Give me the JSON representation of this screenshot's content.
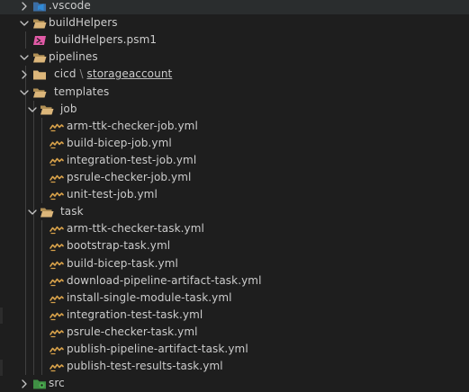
{
  "explorer": {
    "rows": [
      {
        "name": ".vscode",
        "type": "folder",
        "icon": "vscode-folder-icon",
        "expanded": false,
        "depth": 0
      },
      {
        "name": "buildHelpers",
        "type": "folder",
        "icon": "folder-open-icon",
        "expanded": true,
        "depth": 0
      },
      {
        "name": "buildHelpers.psm1",
        "type": "file",
        "icon": "powershell-file-icon",
        "depth": 1
      },
      {
        "name": "pipelines",
        "type": "folder",
        "icon": "folder-open-icon",
        "expanded": true,
        "depth": 0
      },
      {
        "name": "cicd",
        "name_sep": "\\",
        "name_sub": "storageaccount",
        "type": "folder",
        "icon": "folder-icon",
        "expanded": false,
        "depth": 1
      },
      {
        "name": "templates",
        "type": "folder",
        "icon": "folder-open-icon",
        "expanded": true,
        "depth": 1
      },
      {
        "name": "job",
        "type": "folder",
        "icon": "folder-open-icon",
        "expanded": true,
        "depth": 2
      },
      {
        "name": "arm-ttk-checker-job.yml",
        "type": "file",
        "icon": "yaml-file-icon",
        "depth": 3
      },
      {
        "name": "build-bicep-job.yml",
        "type": "file",
        "icon": "yaml-file-icon",
        "depth": 3
      },
      {
        "name": "integration-test-job.yml",
        "type": "file",
        "icon": "yaml-file-icon",
        "depth": 3
      },
      {
        "name": "psrule-checker-job.yml",
        "type": "file",
        "icon": "yaml-file-icon",
        "depth": 3
      },
      {
        "name": "unit-test-job.yml",
        "type": "file",
        "icon": "yaml-file-icon",
        "depth": 3
      },
      {
        "name": "task",
        "type": "folder",
        "icon": "folder-open-icon",
        "expanded": true,
        "depth": 2
      },
      {
        "name": "arm-ttk-checker-task.yml",
        "type": "file",
        "icon": "yaml-file-icon",
        "depth": 3
      },
      {
        "name": "bootstrap-task.yml",
        "type": "file",
        "icon": "yaml-file-icon",
        "depth": 3
      },
      {
        "name": "build-bicep-task.yml",
        "type": "file",
        "icon": "yaml-file-icon",
        "depth": 3
      },
      {
        "name": "download-pipeline-artifact-task.yml",
        "type": "file",
        "icon": "yaml-file-icon",
        "depth": 3
      },
      {
        "name": "install-single-module-task.yml",
        "type": "file",
        "icon": "yaml-file-icon",
        "depth": 3
      },
      {
        "name": "integration-test-task.yml",
        "type": "file",
        "icon": "yaml-file-icon",
        "depth": 3
      },
      {
        "name": "psrule-checker-task.yml",
        "type": "file",
        "icon": "yaml-file-icon",
        "depth": 3
      },
      {
        "name": "publish-pipeline-artifact-task.yml",
        "type": "file",
        "icon": "yaml-file-icon",
        "depth": 3
      },
      {
        "name": "publish-test-results-task.yml",
        "type": "file",
        "icon": "yaml-file-icon",
        "depth": 3
      },
      {
        "name": "src",
        "type": "folder",
        "icon": "src-folder-icon",
        "expanded": false,
        "depth": 0
      }
    ]
  },
  "colors": {
    "background": "#1e1e1e",
    "text": "#cccccc",
    "folder": "#dcb67a",
    "yaml": "#d7a14a",
    "powershell": "#e15aa6",
    "vscode": "#2f8ad6",
    "src": "#4caf50",
    "guide": "#404040"
  }
}
